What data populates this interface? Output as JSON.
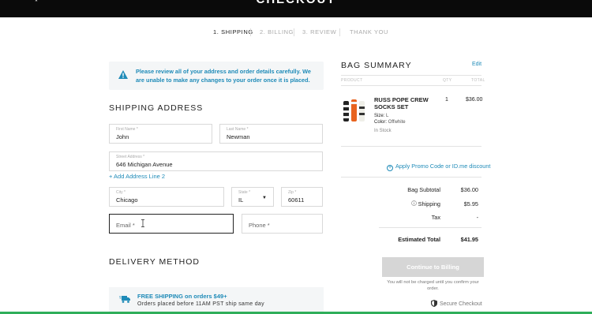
{
  "header": {
    "brand": "CHECKOUT",
    "corner_mark": "*"
  },
  "steps": [
    {
      "label": "1. SHIPPING",
      "active": true
    },
    {
      "label": "2. BILLING",
      "active": false
    },
    {
      "label": "3. REVIEW",
      "active": false
    },
    {
      "label": "THANK YOU",
      "active": false
    }
  ],
  "notice": {
    "text": "Please review all of your address and order details carefully. We are unable to make any changes to your order once it is placed."
  },
  "shipping": {
    "title": "SHIPPING ADDRESS",
    "first_name": {
      "label": "First Name *",
      "value": "John"
    },
    "last_name": {
      "label": "Last Name *",
      "value": "Newman"
    },
    "street": {
      "label": "Street Address *",
      "value": "646 Michigan Avenue"
    },
    "add_line": "+ Add Address Line 2",
    "city": {
      "label": "City *",
      "value": "Chicago"
    },
    "state": {
      "label": "State *",
      "value": "IL"
    },
    "zip": {
      "label": "Zip *",
      "value": "60611"
    },
    "email": {
      "placeholder": "Email *"
    },
    "phone": {
      "placeholder": "Phone *"
    }
  },
  "delivery": {
    "title": "DELIVERY METHOD",
    "free_shipping": "FREE SHIPPING on orders $49+",
    "cutoff": "Orders placed before 11AM PST ship same day"
  },
  "bag": {
    "title": "BAG SUMMARY",
    "edit": "Edit",
    "col_product": "PRODUCT",
    "col_qty": "QTY",
    "col_total": "TOTAL",
    "item": {
      "name": "RUSS POPE CREW SOCKS SET",
      "size_label": "Size:",
      "size": "L",
      "color_label": "Color:",
      "color": "Offwhite",
      "stock": "In Stock",
      "qty": "1",
      "price": "$36.00"
    },
    "promo": "Apply Promo Code or ID.me discount",
    "subtotal_label": "Bag Subtotal",
    "subtotal": "$36.00",
    "shipping_label": "Shipping",
    "shipping": "$5.95",
    "tax_label": "Tax",
    "tax": "-",
    "total_label": "Estimated Total",
    "total": "$41.95",
    "continue": "Continue to Billing",
    "note": "You will not be charged until you confirm your order.",
    "secure": "Secure Checkout"
  },
  "colors": {
    "accent": "#1f8bb8",
    "topbar": "#0a0a0a",
    "bottom_bar": "#2fae5a",
    "button_disabled": "#d6d6d6"
  }
}
